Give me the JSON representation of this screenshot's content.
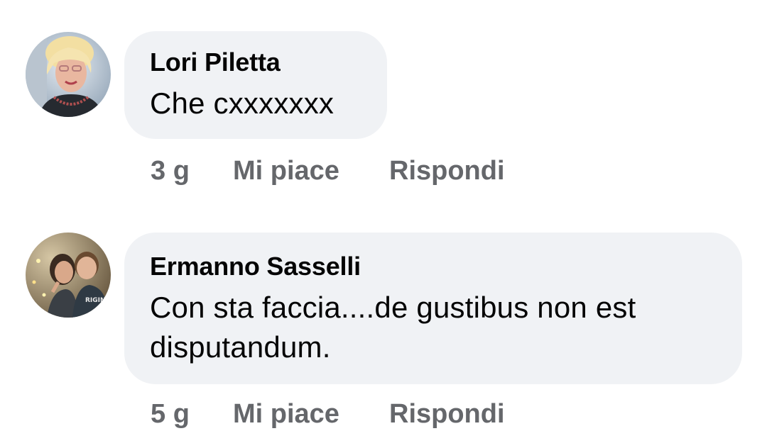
{
  "comments": [
    {
      "author": "Lori Piletta",
      "text": "Che cxxxxxxx",
      "time": "3 g",
      "like_label": "Mi piace",
      "reply_label": "Rispondi",
      "avatar_icon": "profile-photo-icon"
    },
    {
      "author": "Ermanno Sasselli",
      "text": "Con sta faccia....de gustibus non est disputandum.",
      "time": "5 g",
      "like_label": "Mi piace",
      "reply_label": "Rispondi",
      "avatar_icon": "profile-photo-icon"
    }
  ],
  "colors": {
    "bubble_bg": "#f0f2f5",
    "text": "#050505",
    "meta": "#65676b"
  }
}
